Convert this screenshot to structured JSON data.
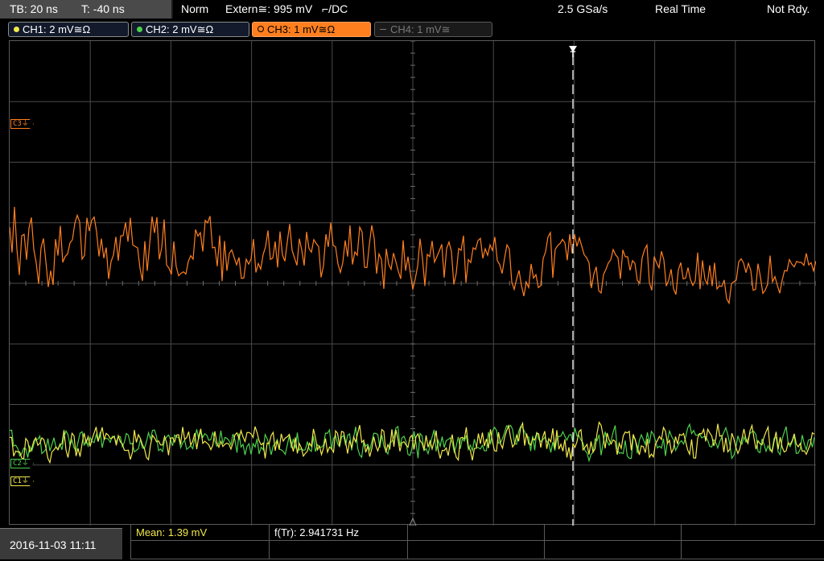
{
  "status": {
    "timebase": "TB: 20 ns",
    "trigger_time": "T: -40 ns",
    "mode": "Norm",
    "trigger_source": "Extern≅: 995 mV",
    "trigger_slope": "⌐/DC",
    "sample_rate": "2.5 GSa/s",
    "acquisition": "Real Time",
    "state": "Not Rdy."
  },
  "channels": [
    {
      "label": "CH1: 2 mV≅Ω",
      "color": "#f2e84a",
      "active": true
    },
    {
      "label": "CH2: 2 mV≅Ω",
      "color": "#4cd04c",
      "active": true
    },
    {
      "label": "CH3: 1 mV≅Ω",
      "color": "#ff7f1f",
      "active": true,
      "selected": true
    },
    {
      "label": "CH4: 1 mV≅",
      "color": "#9a9a9a",
      "active": false
    }
  ],
  "markers": {
    "c3": "C3⏚",
    "c2": "C2⏚",
    "c1": "C1⏚",
    "trigger": "T"
  },
  "measurements": {
    "mean": "Mean: 1.39 mV",
    "freq": "f(Tr): 2.941731 Hz"
  },
  "datetime": "2016-11-03 11:11",
  "colors": {
    "ch1": "#f2e84a",
    "ch2": "#4cd04c",
    "ch3": "#ff7f1f",
    "grid": "#4a4a4a",
    "selected_tab": "#ff7f1f"
  }
}
